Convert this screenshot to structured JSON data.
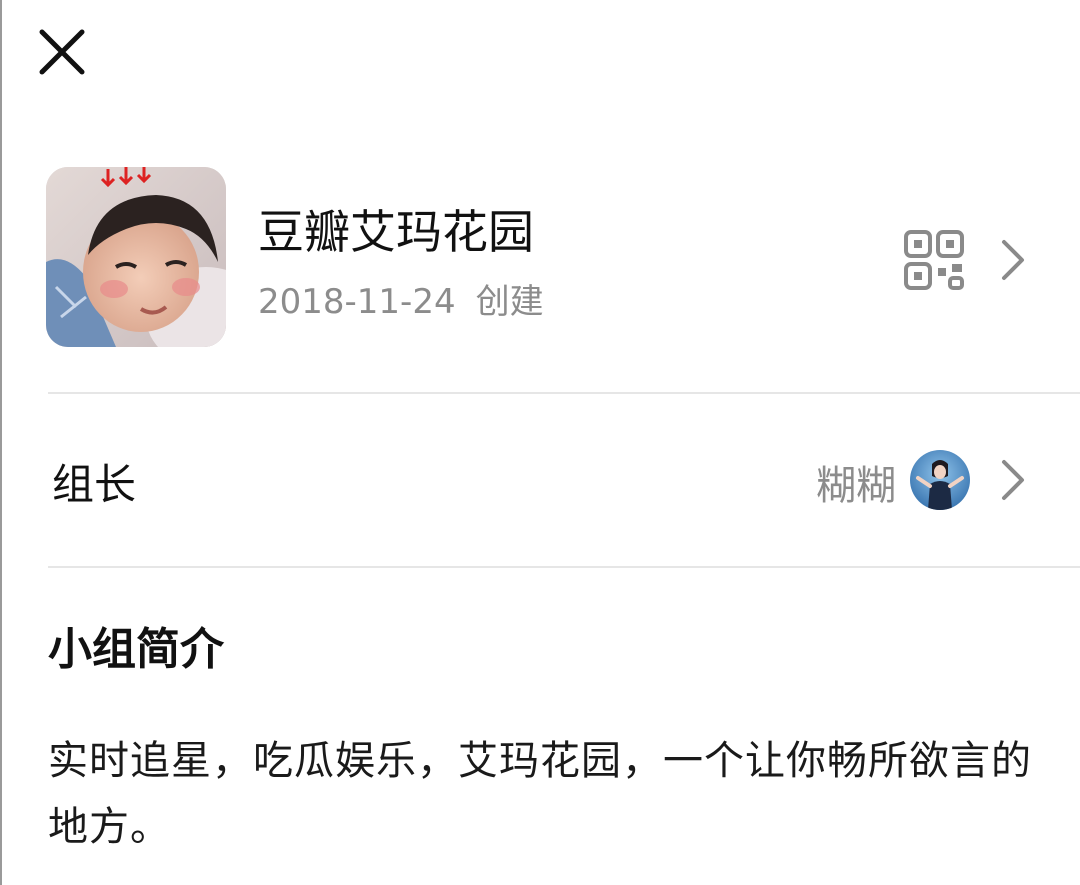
{
  "header": {
    "close_icon": "close-icon"
  },
  "group": {
    "name": "豆瓣艾玛花园",
    "created_date": "2018-11-24",
    "created_suffix": "创建",
    "avatar_icon": "group-avatar-photo",
    "qr_icon": "qr-code-icon"
  },
  "owner": {
    "label": "组长",
    "name": "糊糊",
    "avatar_icon": "owner-avatar-photo"
  },
  "intro": {
    "heading": "小组简介",
    "text": "实时追星，吃瓜娱乐，艾玛花园，一个让你畅所欲言的地方。"
  },
  "colors": {
    "primary_text": "#111111",
    "secondary_text": "#8c8c8c",
    "divider": "#e6e6e6",
    "background": "#ffffff"
  }
}
